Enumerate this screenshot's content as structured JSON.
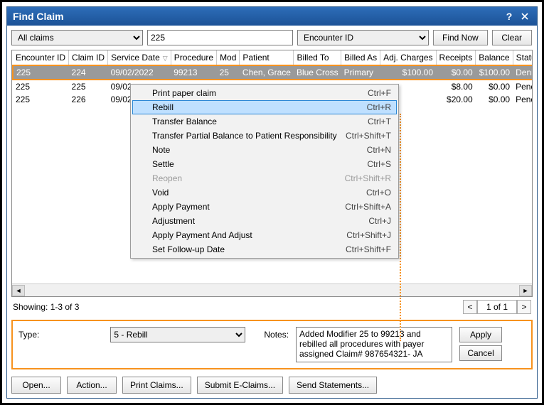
{
  "title": "Find Claim",
  "filters": {
    "scope_options": [
      "All claims"
    ],
    "scope_value": "All claims",
    "search_value": "225",
    "field_options": [
      "Encounter ID"
    ],
    "field_value": "Encounter ID",
    "find_label": "Find Now",
    "clear_label": "Clear"
  },
  "columns": [
    "Encounter ID",
    "Claim ID",
    "Service Date",
    "Procedure",
    "Mod",
    "Patient",
    "Billed To",
    "Billed As",
    "Adj. Charges",
    "Receipts",
    "Balance",
    "Status"
  ],
  "sorted_col_index": 2,
  "rows": [
    {
      "encounter": "225",
      "claim": "224",
      "service": "09/02/2022",
      "proc": "99213",
      "mod": "25",
      "patient": "Chen, Grace",
      "billedto": "Blue Cross",
      "billedas": "Primary",
      "adj": "$100.00",
      "rec": "$0.00",
      "bal": "$100.00",
      "status": "Denied",
      "selected": true
    },
    {
      "encounter": "225",
      "claim": "225",
      "service": "09/02",
      "proc": "",
      "mod": "",
      "patient": "",
      "billedto": "",
      "billedas": "",
      "adj": "",
      "rec": "$8.00",
      "bal": "$0.00",
      "status": "Pending insurance",
      "selected": false
    },
    {
      "encounter": "225",
      "claim": "226",
      "service": "09/02",
      "proc": "",
      "mod": "",
      "patient": "",
      "billedto": "",
      "billedas": "",
      "adj": "",
      "rec": "$20.00",
      "bal": "$0.00",
      "status": "Pending insurance",
      "selected": false
    }
  ],
  "showing": "Showing: 1-3 of 3",
  "pager": {
    "prev": "<",
    "label": "1 of 1",
    "next": ">"
  },
  "edit": {
    "type_label": "Type:",
    "type_value": "5 - Rebill",
    "notes_label": "Notes:",
    "notes_value": "Added Modifier 25 to 99213 and rebilled all procedures with payer assigned Claim# 987654321- JA",
    "apply_label": "Apply",
    "cancel_label": "Cancel"
  },
  "toolbar": {
    "open": "Open...",
    "action": "Action...",
    "print": "Print Claims...",
    "submit": "Submit E-Claims...",
    "send": "Send Statements..."
  },
  "context_menu": [
    {
      "label": "Print paper claim",
      "shortcut": "Ctrl+F",
      "state": "normal"
    },
    {
      "label": "Rebill",
      "shortcut": "Ctrl+R",
      "state": "highlight"
    },
    {
      "label": "Transfer Balance",
      "shortcut": "Ctrl+T",
      "state": "normal"
    },
    {
      "label": "Transfer Partial Balance to Patient Responsibility",
      "shortcut": "Ctrl+Shift+T",
      "state": "normal"
    },
    {
      "label": "Note",
      "shortcut": "Ctrl+N",
      "state": "normal"
    },
    {
      "label": "Settle",
      "shortcut": "Ctrl+S",
      "state": "normal"
    },
    {
      "label": "Reopen",
      "shortcut": "Ctrl+Shift+R",
      "state": "disabled"
    },
    {
      "label": "Void",
      "shortcut": "Ctrl+O",
      "state": "normal"
    },
    {
      "label": "Apply Payment",
      "shortcut": "Ctrl+Shift+A",
      "state": "normal"
    },
    {
      "label": "Adjustment",
      "shortcut": "Ctrl+J",
      "state": "normal"
    },
    {
      "label": "Apply Payment And Adjust",
      "shortcut": "Ctrl+Shift+J",
      "state": "normal"
    },
    {
      "label": "Set Follow-up Date",
      "shortcut": "Ctrl+Shift+F",
      "state": "normal"
    }
  ]
}
